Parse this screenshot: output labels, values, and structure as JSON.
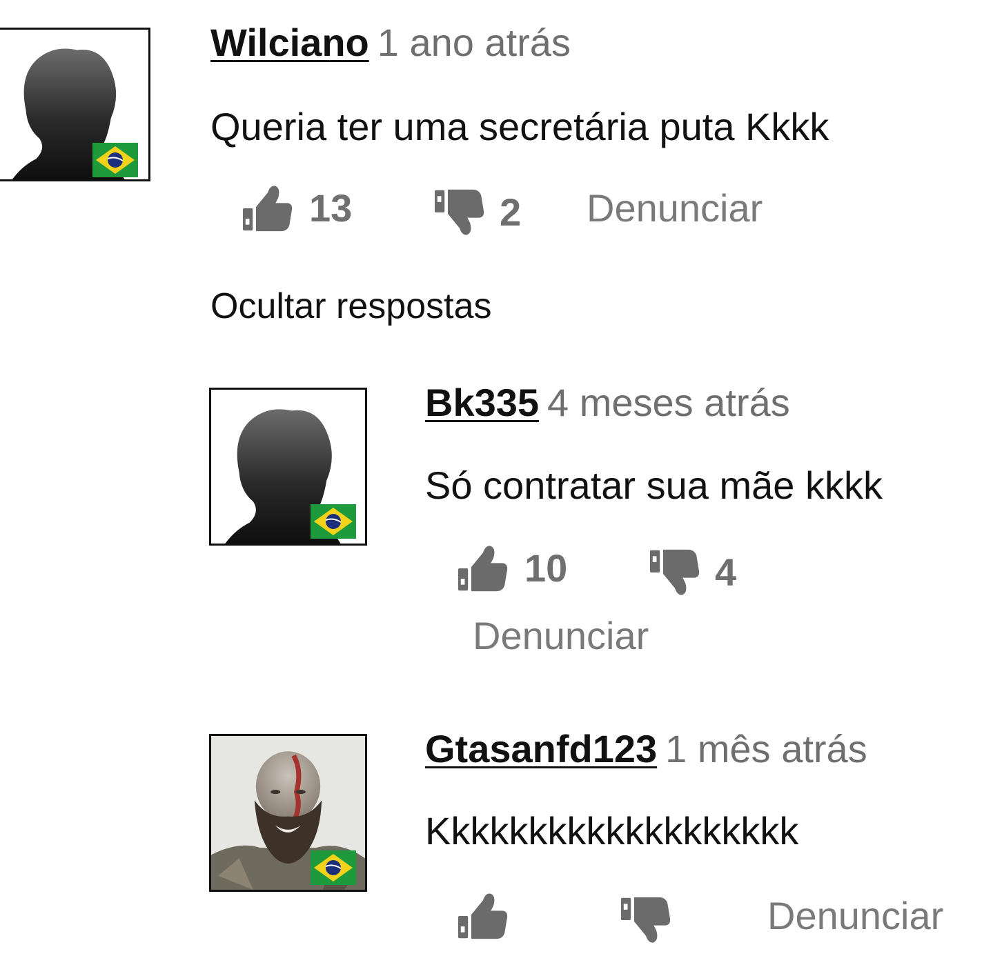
{
  "comments": [
    {
      "username": "Wilciano",
      "timestamp": "1 ano atrás",
      "text": "Queria ter uma secretária puta Kkkk",
      "likes": "13",
      "dislikes": "2",
      "report_label": "Denunciar",
      "avatar": "silhouette-avatar",
      "flag": "brazil-flag"
    }
  ],
  "replies_toggle_label": "Ocultar respostas",
  "replies": [
    {
      "username": "Bk335",
      "timestamp": "4 meses atrás",
      "text": "Só contratar sua mãe kkkk",
      "likes": "10",
      "dislikes": "4",
      "report_label": "Denunciar",
      "avatar": "silhouette-avatar",
      "flag": "brazil-flag"
    },
    {
      "username": "Gtasanfd123",
      "timestamp": "1 mês atrás",
      "text": "Kkkkkkkkkkkkkkkkkkk",
      "likes": "",
      "dislikes": "",
      "report_label": "Denunciar",
      "avatar": "bearded-man-avatar",
      "flag": "brazil-flag"
    }
  ],
  "colors": {
    "text": "#111111",
    "muted": "#6f6f6f",
    "icon": "#6b6b6b",
    "flag_green": "#1e9a3c",
    "flag_yellow": "#f2d21b",
    "flag_blue": "#1b2f7a"
  }
}
